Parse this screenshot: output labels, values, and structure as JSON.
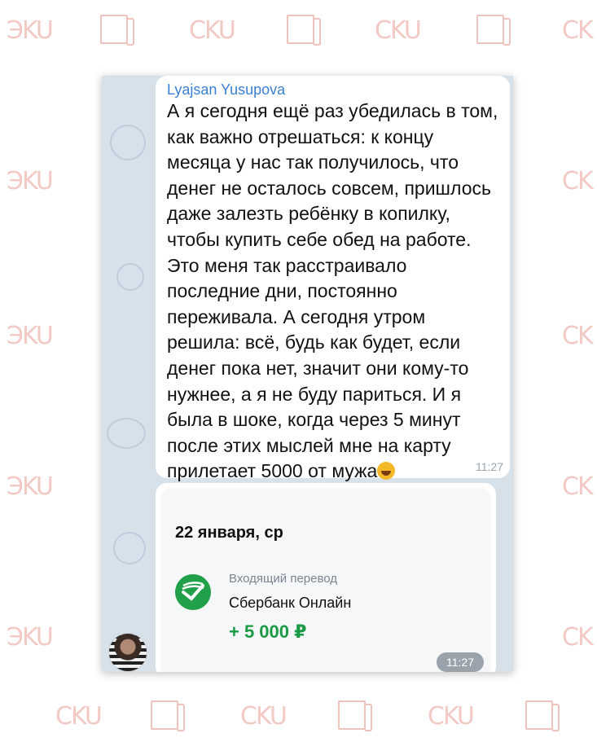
{
  "message": {
    "sender": "Lyajsan Yusupova",
    "text": "А я сегодня ещё раз убедилась в том, как важно отрешаться: к концу месяца у нас так получилось, что денег не осталось совсем, пришлось даже залезть ребёнку в копилку, чтобы купить себе обед на работе. Это меня так расстраивало последние дни, постоянно переживала. А сегодня утром решила: всё, будь как будет, если денег пока нет, значит они кому-то нужнее, а я не буду париться. И я была в шоке, когда через 5 минут после этих мыслей мне на карту прилетает 5000 от мужа",
    "time": "11:27",
    "emoji": "star-struck-emoji"
  },
  "transaction_card": {
    "date": "22 января, ср",
    "label": "Входящий перевод",
    "bank": "Сбербанк Онлайн",
    "amount": "+ 5 000 ₽",
    "time": "11:27",
    "icon": "sberbank-logo-icon"
  },
  "colors": {
    "chat_background": "#d7e1ea",
    "sender_name": "#3b7fd4",
    "amount": "#1b9a45",
    "watermark": "#f2c9c4"
  }
}
